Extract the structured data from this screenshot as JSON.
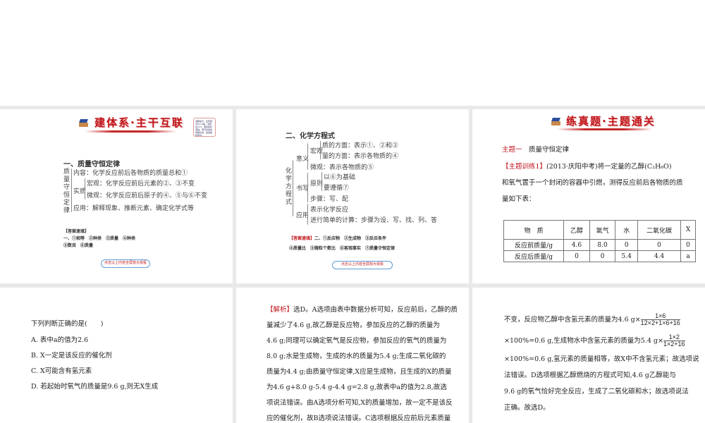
{
  "slide1": {
    "banner": "建体系·主干互联",
    "note": "温馨提示：此套题为Word版，请按住Ctrl，滑动鼠标滚轴，调节合适的观看比例，答案解析附后。",
    "heading": "一、质量守恒定律",
    "side": "质量守恒定律",
    "content": "内容：化学反应前后各物质的质量总和①",
    "essence": "实质",
    "macro": "宏观：化学反应前后元素的②、③不变",
    "micro": "微观：化学反应前后原子的④、⑤与⑥不变",
    "app": "应用：解释现象、推断元素、确定化学式等",
    "answer_label": "【答案速填】",
    "answers1": "一、①相等　②种类　③质量　④种类",
    "answers2": "⑤数目　⑥质量",
    "button": "点击以上内容全屏放大观看"
  },
  "slide2": {
    "heading": "二、化学方程式",
    "side": "化学方程式",
    "meaning": "意义",
    "macro": "宏观",
    "q1": "质的方面：表示①、②和③",
    "q2": "量的方面：表示各物质的④",
    "micro": "微观：表示各物质的⑤",
    "writing": "书写",
    "principle": "原则",
    "p1": "以⑥为基础",
    "p2": "要遵循⑦",
    "steps": "步骤：写、配",
    "application": "应用",
    "a1": "表示化学反应",
    "a2": "进行简单的计算：步骤为设、写、找、列、答",
    "answer_label": "【答案速填】",
    "answers1": "二、①反应物　②生成物　③反应条件",
    "answers2": "④质量比　⑤微粒个数比　⑥客观事实　⑦质量守恒定律",
    "button": "点击以上内容全屏放大观看"
  },
  "slide3": {
    "banner": "练真题·主题通关",
    "topic_label": "主题一",
    "topic": "质量守恒定律",
    "train_label": "【主题训练1】",
    "line1": "(2013·庆阳中考)将一定量的乙醇(C₂H₆O)",
    "line2": "和氧气置于一个封闭的容器中引燃，测得反应前后各物质的质",
    "line3": "量如下表：",
    "table": {
      "headers": [
        "物　质",
        "乙醇",
        "氧气",
        "水",
        "二氧化碳",
        "X"
      ],
      "rows": [
        [
          "反应前质量/g",
          "4.6",
          "8.0",
          "0",
          "0",
          "0"
        ],
        [
          "反应后质量/g",
          "0",
          "0",
          "5.4",
          "4.4",
          "a"
        ]
      ]
    }
  },
  "slide4": {
    "question": "下列判断正确的是(　　)",
    "options": [
      "A. 表中a的值为2.6",
      "B. X一定是该反应的催化剂",
      "C. X可能含有氢元素",
      "D. 若起始时氧气的质量是9.6 g,则无X生成"
    ]
  },
  "slide5": {
    "label": "【解析】",
    "lines": [
      "选D。A选项由表中数据分析可知，反应前后，乙醇的质",
      "量减少了4.6 g,故乙醇是反应物，参加反应的乙醇的质量为",
      "4.6 g;同理可以确定氧气是反应物，参加反应的氧气的质量为",
      "8.0 g;水是生成物，生成的水的质量为5.4 g;生成二氧化碳的",
      "质量为4.4 g;由质量守恒定律,X应是生成物，且生成的X的质量",
      "为4.6 g+8.0 g-5.4 g-4.4 g=2.8 g,故表中a的值为2.8,故选",
      "项说法错误。由A选项分析可知,X的质量增加，故一定不是该反",
      "应的催化剂，故B选项说法错误。C选项根据反应前后元素质量"
    ]
  },
  "slide6": {
    "l1": "不变，反应物乙醇中含氢元素的质量为4.6 g×",
    "f1num": "1×6",
    "f1den": "12×2+1×6+16",
    "l2": "×100%=0.6 g,生成物水中含氢元素的质量为5.4 g×",
    "f2num": "1×2",
    "f2den": "1×2+16",
    "l3": "×100%=0.6 g,氢元素的质量相等，故X中不含氢元素；故选项说",
    "l4": "法错误。D选项根据乙醇燃烧的方程式可知,4.6 g乙醇能与",
    "l5": "9.6 g的氧气恰好完全反应，生成了二氧化碳和水；故选项说法",
    "l6": "正确。故选D。"
  }
}
